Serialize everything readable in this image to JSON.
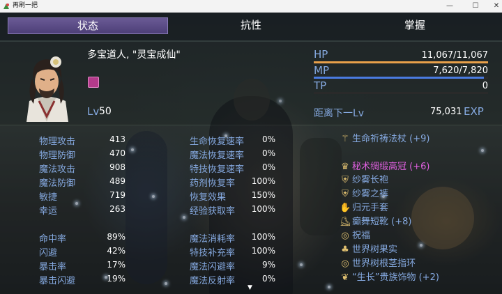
{
  "window": {
    "title": "再刷一把",
    "minimize": "—",
    "maximize": "☐",
    "close": "✕"
  },
  "tabs": [
    {
      "label": "状态",
      "active": true
    },
    {
      "label": "抗性",
      "active": false
    },
    {
      "label": "掌握",
      "active": false
    }
  ],
  "actor": {
    "name": "多宝道人, \"灵宝成仙\"",
    "level_label": "Lv",
    "level": "50",
    "state_icon": "magic-state-icon"
  },
  "gauges": {
    "hp": {
      "label": "HP",
      "value": "11,067/11,067",
      "fill": 1.0,
      "color": "#e8a04a"
    },
    "mp": {
      "label": "MP",
      "value": "7,620/7,820",
      "fill": 0.974,
      "color": "#4a7be0"
    },
    "tp": {
      "label": "TP",
      "value": "0",
      "fill": 0.0,
      "color": "#6ab04a"
    }
  },
  "exp": {
    "label": "距离下一Lv",
    "value": "75,031",
    "unit": "EXP"
  },
  "params": [
    {
      "label": "物理攻击",
      "value": "413"
    },
    {
      "label": "物理防御",
      "value": "470"
    },
    {
      "label": "魔法攻击",
      "value": "908"
    },
    {
      "label": "魔法防御",
      "value": "489"
    },
    {
      "label": "敏捷",
      "value": "719"
    },
    {
      "label": "幸运",
      "value": "263"
    }
  ],
  "xparams": [
    {
      "label": "命中率",
      "value": "89%"
    },
    {
      "label": "闪避",
      "value": "42%"
    },
    {
      "label": "暴击率",
      "value": "17%"
    },
    {
      "label": "暴击闪避",
      "value": "19%"
    }
  ],
  "sparams_top": [
    {
      "label": "生命恢复速率",
      "value": "0%"
    },
    {
      "label": "魔法恢复速率",
      "value": "0%"
    },
    {
      "label": "特技恢复速率",
      "value": "0%"
    },
    {
      "label": "药剂恢复率",
      "value": "100%"
    },
    {
      "label": "恢复效果",
      "value": "150%"
    },
    {
      "label": "经验获取率",
      "value": "100%"
    }
  ],
  "sparams_bottom": [
    {
      "label": "魔法消耗率",
      "value": "100%"
    },
    {
      "label": "特技补充率",
      "value": "100%"
    },
    {
      "label": "魔法闪避率",
      "value": "9%"
    },
    {
      "label": "魔法反射率",
      "value": "0%"
    }
  ],
  "equipment": [
    {
      "name": "生命祈祷法杖 (+9)",
      "icon": "staff-icon",
      "glyph": "⚚",
      "color": "#85a9e0"
    },
    {
      "name": "秘术绸缎高冠 (+6)",
      "icon": "crown-icon",
      "glyph": "♛",
      "color": "#e060e0"
    },
    {
      "name": "纱雾长袍",
      "icon": "robe-icon",
      "glyph": "⛨",
      "color": "#85a9e0"
    },
    {
      "name": "纱雾之裤",
      "icon": "pants-icon",
      "glyph": "⛨",
      "color": "#85a9e0"
    },
    {
      "name": "归元手套",
      "icon": "glove-icon",
      "glyph": "✋",
      "color": "#85a9e0"
    },
    {
      "name": "癫舞短靴 (+8)",
      "icon": "boots-icon",
      "glyph": "⛸",
      "color": "#85a9e0"
    },
    {
      "name": "祝福",
      "icon": "ring-icon",
      "glyph": "◎",
      "color": "#85a9e0"
    },
    {
      "name": "世界树果实",
      "icon": "fruit-icon",
      "glyph": "♣",
      "color": "#85a9e0"
    },
    {
      "name": "世界树根茎指环",
      "icon": "ring-icon",
      "glyph": "◎",
      "color": "#85a9e0"
    },
    {
      "name": "“生长”贵族饰物 (+2)",
      "icon": "accessory-icon",
      "glyph": "❦",
      "color": "#85a9e0"
    }
  ],
  "scroll_indicator": "▼"
}
